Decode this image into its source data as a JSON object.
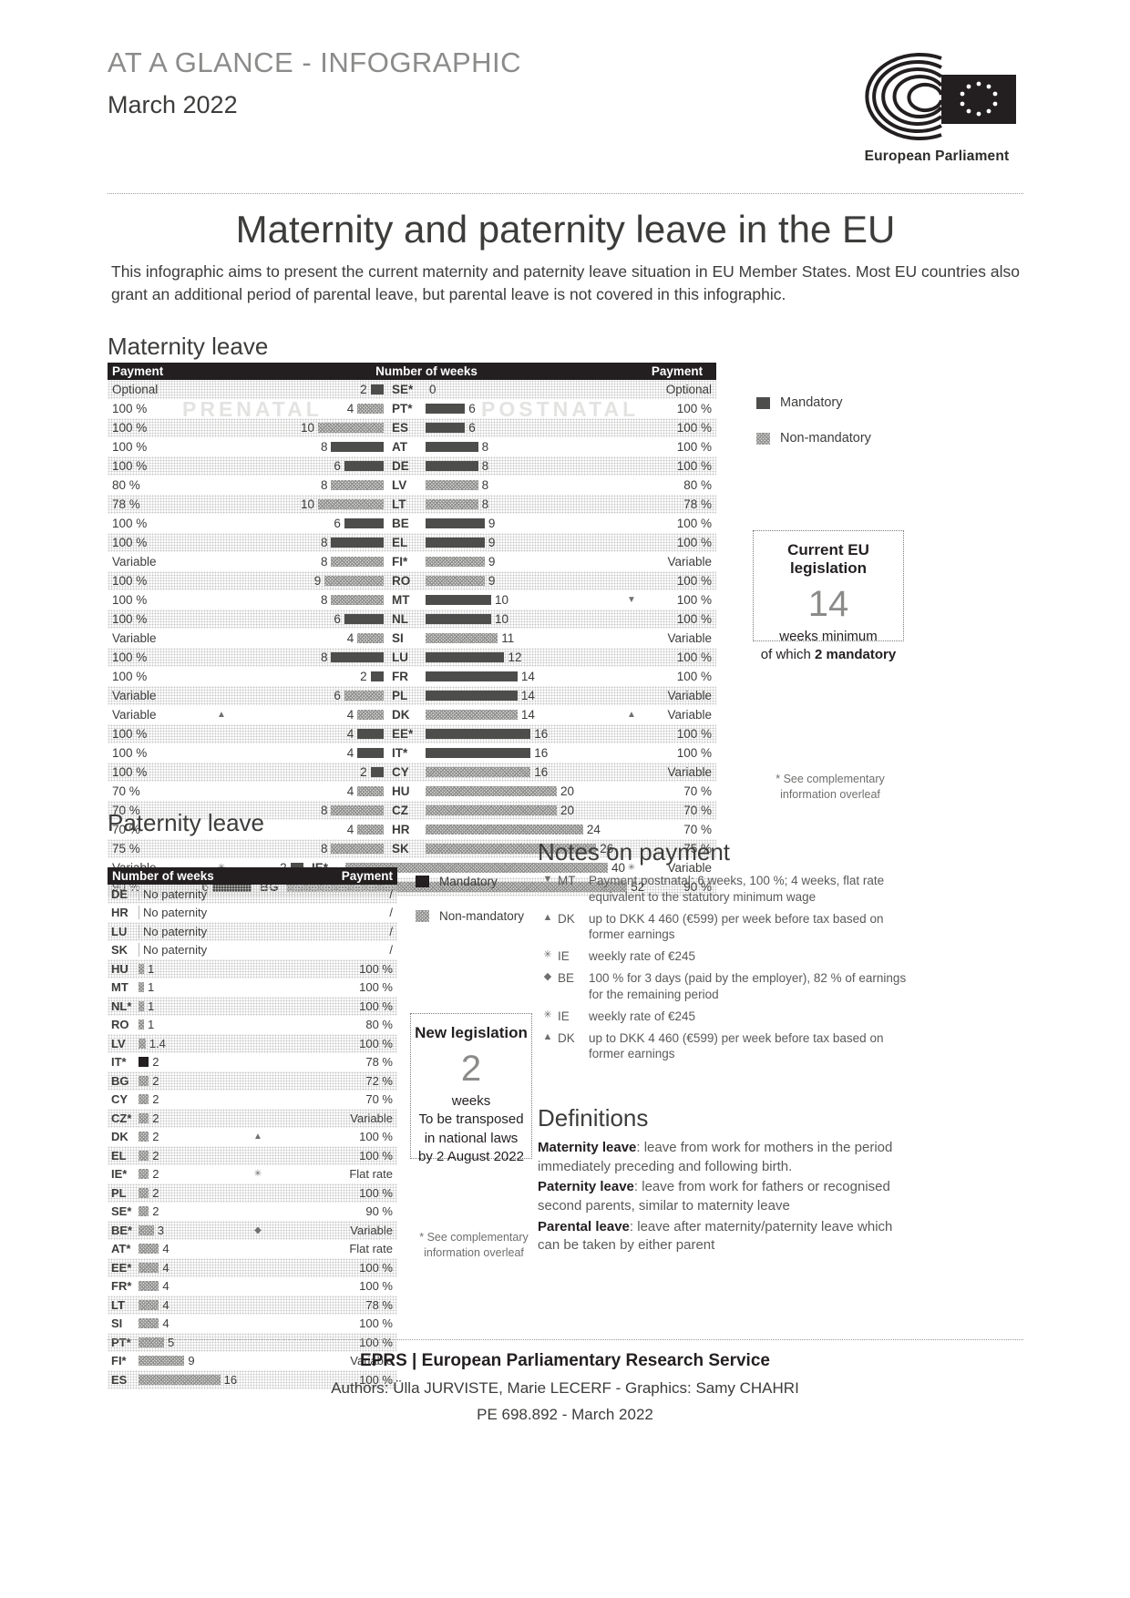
{
  "header": {
    "kicker": "AT A GLANCE - INFOGRAPHIC",
    "dateline": "March 2022",
    "institution": "European Parliament",
    "logo_icon": "european-parliament-logo"
  },
  "title": "Maternity and paternity leave in the EU",
  "intro": "This infographic aims to present the current maternity and paternity leave situation in EU Member States. Most EU countries also grant an additional period of parental leave, but parental leave is not covered in this infographic.",
  "maternity": {
    "section_title": "Maternity leave",
    "head": {
      "payment_left": "Payment",
      "weeks": "Number of weeks",
      "payment_right": "Payment"
    },
    "watermark_prenatal": "PRENATAL",
    "watermark_postnatal": "POSTNATAL",
    "legend": [
      {
        "label": "Mandatory",
        "type": "m"
      },
      {
        "label": "Non-mandatory",
        "type": "n"
      }
    ],
    "eu_box": {
      "title": "Current EU legislation",
      "number": "14",
      "line1": "weeks minimum",
      "line2_pre": "of which ",
      "line2_bold": "2 mandatory"
    },
    "footnote": "* See complementary information overleaf"
  },
  "paternity": {
    "section_title": "Paternity leave",
    "head": {
      "weeks": "Number of weeks",
      "payment": "Payment"
    },
    "legend": [
      {
        "label": "Mandatory",
        "type": "m"
      },
      {
        "label": "Non-mandatory",
        "type": "n"
      }
    ],
    "new_box": {
      "title": "New legislation",
      "number": "2",
      "unit": "weeks",
      "line1": "To be transposed",
      "line2": "in national laws",
      "line3": "by 2 August 2022"
    },
    "footnote": "* See complementary information overleaf",
    "no_paternity_label": "No paternity"
  },
  "notes": {
    "title": "Notes on payment",
    "items": [
      {
        "glyph": "▼",
        "country": "MT",
        "text": "Payment postnatal: 6 weeks, 100 %; 4 weeks, flat rate equivalent to the statutory minimum wage"
      },
      {
        "glyph": "▲",
        "country": "DK",
        "text": "up to DKK 4 460 (€599) per week before tax based on former earnings"
      },
      {
        "glyph": "✳",
        "country": "IE",
        "text": "weekly rate of €245"
      },
      {
        "glyph": "◆",
        "country": "BE",
        "text": "100 % for 3 days (paid by the employer), 82 % of earnings for the remaining period"
      },
      {
        "glyph": "✳",
        "country": "IE",
        "text": "weekly rate of €245"
      },
      {
        "glyph": "▲",
        "country": "DK",
        "text": "up to DKK 4 460 (€599) per week before tax based on former earnings"
      }
    ]
  },
  "definitions": {
    "title": "Definitions",
    "items": [
      {
        "term": "Maternity leave",
        "text": ": leave from work for mothers in the period immediately preceding and following birth."
      },
      {
        "term": "Paternity leave",
        "text": ": leave from work for fathers or recognised second parents, similar to maternity leave"
      },
      {
        "term": "Parental leave",
        "text": ": leave after maternity/paternity leave which can be taken by either parent"
      }
    ]
  },
  "footer": {
    "line1": "EPRS | European Parliamentary Research Service",
    "line2": "Authors: Ülla JURVISTE, Marie LECERF - Graphics: Samy CHAHRI",
    "line3": "PE 698.892 - March 2022"
  },
  "chart_data": {
    "type": "bar",
    "title": "Maternity and paternity leave in the EU",
    "charts": [
      {
        "name": "Maternity leave",
        "type": "diverging-bar",
        "xlabel": "Number of weeks",
        "categories_axis": "country",
        "series_names": [
          "prenatal",
          "postnatal"
        ],
        "rows": [
          {
            "code": "SE*",
            "pay_left": "Optional",
            "prenatal": 2,
            "pre_type": "m",
            "postnatal": 0,
            "post_type": "n",
            "pay_right": "Optional"
          },
          {
            "code": "PT*",
            "pay_left": "100 %",
            "prenatal": 4,
            "pre_type": "n",
            "postnatal": 6,
            "post_type": "m",
            "pay_right": "100 %"
          },
          {
            "code": "ES",
            "pay_left": "100 %",
            "prenatal": 10,
            "pre_type": "n",
            "postnatal": 6,
            "post_type": "m",
            "pay_right": "100 %"
          },
          {
            "code": "AT",
            "pay_left": "100 %",
            "prenatal": 8,
            "pre_type": "m",
            "postnatal": 8,
            "post_type": "m",
            "pay_right": "100 %"
          },
          {
            "code": "DE",
            "pay_left": "100 %",
            "prenatal": 6,
            "pre_type": "m",
            "postnatal": 8,
            "post_type": "m",
            "pay_right": "100 %"
          },
          {
            "code": "LV",
            "pay_left": "80 %",
            "prenatal": 8,
            "pre_type": "n",
            "postnatal": 8,
            "post_type": "n",
            "pay_right": "80 %"
          },
          {
            "code": "LT",
            "pay_left": "78 %",
            "prenatal": 10,
            "pre_type": "n",
            "postnatal": 8,
            "post_type": "n",
            "pay_right": "78 %"
          },
          {
            "code": "BE",
            "pay_left": "100 %",
            "prenatal": 6,
            "pre_type": "m",
            "postnatal": 9,
            "post_type": "m",
            "pay_right": "100 %"
          },
          {
            "code": "EL",
            "pay_left": "100 %",
            "prenatal": 8,
            "pre_type": "m",
            "postnatal": 9,
            "post_type": "m",
            "pay_right": "100 %"
          },
          {
            "code": "FI*",
            "pay_left": "Variable",
            "prenatal": 8,
            "pre_type": "n",
            "postnatal": 9,
            "post_type": "n",
            "pay_right": "Variable"
          },
          {
            "code": "RO",
            "pay_left": "100 %",
            "prenatal": 9,
            "pre_type": "n",
            "postnatal": 9,
            "post_type": "n",
            "pay_right": "100 %"
          },
          {
            "code": "MT",
            "pay_left": "100 %",
            "prenatal": 8,
            "pre_type": "n",
            "postnatal": 10,
            "post_type": "m",
            "pay_right": "100 %",
            "marker_right": "▼"
          },
          {
            "code": "NL",
            "pay_left": "100 %",
            "prenatal": 6,
            "pre_type": "m",
            "postnatal": 10,
            "post_type": "m",
            "pay_right": "100 %"
          },
          {
            "code": "SI",
            "pay_left": "Variable",
            "prenatal": 4,
            "pre_type": "n",
            "postnatal": 11,
            "post_type": "n",
            "pay_right": "Variable"
          },
          {
            "code": "LU",
            "pay_left": "100 %",
            "prenatal": 8,
            "pre_type": "m",
            "postnatal": 12,
            "post_type": "m",
            "pay_right": "100 %"
          },
          {
            "code": "FR",
            "pay_left": "100 %",
            "prenatal": 2,
            "pre_type": "m",
            "postnatal": 14,
            "post_type": "m",
            "pay_right": "100 %"
          },
          {
            "code": "PL",
            "pay_left": "Variable",
            "prenatal": 6,
            "pre_type": "n",
            "postnatal": 14,
            "post_type": "m",
            "pay_right": "Variable"
          },
          {
            "code": "DK",
            "pay_left": "Variable",
            "prenatal": 4,
            "pre_type": "n",
            "postnatal": 14,
            "post_type": "n",
            "pay_right": "Variable",
            "marker_left": "▲",
            "marker_right": "▲"
          },
          {
            "code": "EE*",
            "pay_left": "100 %",
            "prenatal": 4,
            "pre_type": "m",
            "postnatal": 16,
            "post_type": "m",
            "pay_right": "100 %"
          },
          {
            "code": "IT*",
            "pay_left": "100 %",
            "prenatal": 4,
            "pre_type": "m",
            "postnatal": 16,
            "post_type": "m",
            "pay_right": "100 %"
          },
          {
            "code": "CY",
            "pay_left": "100 %",
            "prenatal": 2,
            "pre_type": "m",
            "postnatal": 16,
            "post_type": "n",
            "pay_right": "Variable"
          },
          {
            "code": "HU",
            "pay_left": "70 %",
            "prenatal": 4,
            "pre_type": "n",
            "postnatal": 20,
            "post_type": "n",
            "pay_right": "70 %"
          },
          {
            "code": "CZ",
            "pay_left": "70 %",
            "prenatal": 8,
            "pre_type": "n",
            "postnatal": 20,
            "post_type": "n",
            "pay_right": "70 %"
          },
          {
            "code": "HR",
            "pay_left": "70 %",
            "prenatal": 4,
            "pre_type": "n",
            "postnatal": 24,
            "post_type": "n",
            "pay_right": "70 %"
          },
          {
            "code": "SK",
            "pay_left": "75 %",
            "prenatal": 8,
            "pre_type": "n",
            "postnatal": 26,
            "post_type": "n",
            "pay_right": "75 %"
          },
          {
            "code": "IE*",
            "pay_left": "Variable",
            "prenatal": 2,
            "pre_type": "m",
            "postnatal": 40,
            "post_type": "n",
            "pay_right": "Variable",
            "marker_left": "✳",
            "marker_right": "✳"
          },
          {
            "code": "BG",
            "pay_left": "90 %",
            "prenatal": 6,
            "pre_type": "m",
            "postnatal": 52,
            "post_type": "n",
            "pay_right": "90 %"
          }
        ]
      },
      {
        "name": "Paternity leave",
        "type": "bar",
        "xlabel": "Number of weeks",
        "rows": [
          {
            "code": "DE",
            "weeks": null,
            "label": "No paternity",
            "type": "none",
            "pay": "/"
          },
          {
            "code": "HR",
            "weeks": null,
            "label": "No paternity",
            "type": "none",
            "pay": "/"
          },
          {
            "code": "LU",
            "weeks": null,
            "label": "No paternity",
            "type": "none",
            "pay": "/"
          },
          {
            "code": "SK",
            "weeks": null,
            "label": "No paternity",
            "type": "none",
            "pay": "/"
          },
          {
            "code": "HU",
            "weeks": 1,
            "label": "1",
            "type": "n",
            "pay": "100 %"
          },
          {
            "code": "MT",
            "weeks": 1,
            "label": "1",
            "type": "n",
            "pay": "100 %"
          },
          {
            "code": "NL*",
            "weeks": 1,
            "label": "1",
            "type": "n",
            "pay": "100 %"
          },
          {
            "code": "RO",
            "weeks": 1,
            "label": "1",
            "type": "n",
            "pay": "80 %"
          },
          {
            "code": "LV",
            "weeks": 1.4,
            "label": "1.4",
            "type": "n",
            "pay": "100 %"
          },
          {
            "code": "IT*",
            "weeks": 2,
            "label": "2",
            "type": "m",
            "pay": "78 %"
          },
          {
            "code": "BG",
            "weeks": 2,
            "label": "2",
            "type": "n",
            "pay": "72 %"
          },
          {
            "code": "CY",
            "weeks": 2,
            "label": "2",
            "type": "n",
            "pay": "70 %"
          },
          {
            "code": "CZ*",
            "weeks": 2,
            "label": "2",
            "type": "n",
            "pay": "Variable"
          },
          {
            "code": "DK",
            "weeks": 2,
            "label": "2",
            "type": "n",
            "pay": "100 %",
            "marker": "▲"
          },
          {
            "code": "EL",
            "weeks": 2,
            "label": "2",
            "type": "n",
            "pay": "100 %"
          },
          {
            "code": "IE*",
            "weeks": 2,
            "label": "2",
            "type": "n",
            "pay": "Flat rate",
            "marker": "✳"
          },
          {
            "code": "PL",
            "weeks": 2,
            "label": "2",
            "type": "n",
            "pay": "100 %"
          },
          {
            "code": "SE*",
            "weeks": 2,
            "label": "2",
            "type": "n",
            "pay": "90 %"
          },
          {
            "code": "BE*",
            "weeks": 3,
            "label": "3",
            "type": "n",
            "pay": "Variable",
            "marker": "◆"
          },
          {
            "code": "AT*",
            "weeks": 4,
            "label": "4",
            "type": "n",
            "pay": "Flat rate"
          },
          {
            "code": "EE*",
            "weeks": 4,
            "label": "4",
            "type": "n",
            "pay": "100 %"
          },
          {
            "code": "FR*",
            "weeks": 4,
            "label": "4",
            "type": "n",
            "pay": "100 %"
          },
          {
            "code": "LT",
            "weeks": 4,
            "label": "4",
            "type": "n",
            "pay": "78 %"
          },
          {
            "code": "SI",
            "weeks": 4,
            "label": "4",
            "type": "n",
            "pay": "100 %"
          },
          {
            "code": "PT*",
            "weeks": 5,
            "label": "5",
            "type": "n",
            "pay": "100 %"
          },
          {
            "code": "FI*",
            "weeks": 9,
            "label": "9",
            "type": "n",
            "pay": "Variable"
          },
          {
            "code": "ES",
            "weeks": 16,
            "label": "16",
            "type": "n",
            "pay": "100 %"
          }
        ]
      }
    ]
  }
}
